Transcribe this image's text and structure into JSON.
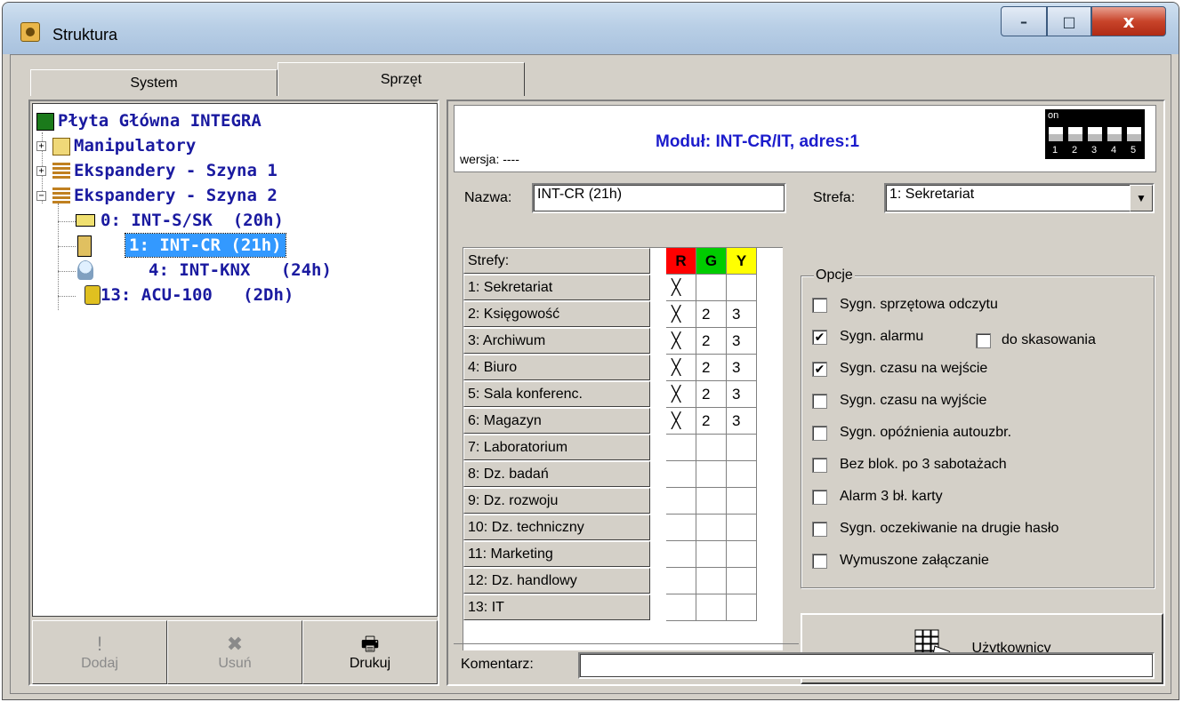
{
  "window": {
    "title": "Struktura",
    "min_label": "–",
    "max_label": "□",
    "close_label": "x"
  },
  "tabs": [
    {
      "label": "System",
      "active": false
    },
    {
      "label": "Sprzęt",
      "active": true
    }
  ],
  "tree": {
    "root": "Płyta Główna INTEGRA",
    "manipulatory": "Manipulatory",
    "szyna1": "Ekspandery - Szyna 1",
    "szyna2": "Ekspandery - Szyna 2",
    "items": [
      "0: INT-S/SK  (20h)",
      "1: INT-CR (21h)",
      "4: INT-KNX   (24h)",
      "13: ACU-100   (2Dh)"
    ],
    "selected_index": 1
  },
  "left_buttons": {
    "add": "Dodaj",
    "remove": "Usuń",
    "print": "Drukuj"
  },
  "module": {
    "title": "Moduł: INT-CR/IT, adres:1",
    "version": "wersja: ----",
    "dip_on_label": "on",
    "dip_numbers": [
      "1",
      "2",
      "3",
      "4",
      "5"
    ]
  },
  "form": {
    "name_label": "Nazwa:",
    "name_value": "INT-CR (21h)",
    "zone_label": "Strefa:",
    "zone_value": "1: Sekretariat"
  },
  "zones_table": {
    "header": "Strefy:",
    "col_labels": [
      "R",
      "G",
      "Y"
    ],
    "col_colors": [
      "#ff0000",
      "#00cc00",
      "#ffff00"
    ],
    "rows": [
      {
        "name": "1: Sekretariat",
        "r": "╳",
        "g": "",
        "y": ""
      },
      {
        "name": "2: Księgowość",
        "r": "╳",
        "g": "2",
        "y": "3"
      },
      {
        "name": "3: Archiwum",
        "r": "╳",
        "g": "2",
        "y": "3"
      },
      {
        "name": "4: Biuro",
        "r": "╳",
        "g": "2",
        "y": "3"
      },
      {
        "name": "5: Sala konferenc.",
        "r": "╳",
        "g": "2",
        "y": "3"
      },
      {
        "name": "6: Magazyn",
        "r": "╳",
        "g": "2",
        "y": "3"
      },
      {
        "name": "7: Laboratorium",
        "r": "",
        "g": "",
        "y": ""
      },
      {
        "name": "8: Dz. badań",
        "r": "",
        "g": "",
        "y": ""
      },
      {
        "name": "9: Dz. rozwoju",
        "r": "",
        "g": "",
        "y": ""
      },
      {
        "name": "10: Dz. techniczny",
        "r": "",
        "g": "",
        "y": ""
      },
      {
        "name": "11: Marketing",
        "r": "",
        "g": "",
        "y": ""
      },
      {
        "name": "12: Dz. handlowy",
        "r": "",
        "g": "",
        "y": ""
      },
      {
        "name": "13: IT",
        "r": "",
        "g": "",
        "y": ""
      }
    ]
  },
  "options": {
    "title": "Opcje",
    "items": [
      {
        "label": "Sygn. sprzętowa odczytu",
        "checked": false
      },
      {
        "label": "Sygn. alarmu",
        "checked": true
      },
      {
        "label": "Sygn. czasu na wejście",
        "checked": true
      },
      {
        "label": "Sygn. czasu na wyjście",
        "checked": false
      },
      {
        "label": "Sygn. opóźnienia autouzbr.",
        "checked": false
      },
      {
        "label": "Bez blok. po 3 sabotażach",
        "checked": false
      },
      {
        "label": "Alarm 3 bł. karty",
        "checked": false
      },
      {
        "label": "Sygn. oczekiwanie na drugie hasło",
        "checked": false
      },
      {
        "label": "Wymuszone załączanie",
        "checked": false
      }
    ],
    "extra": {
      "label": "do skasowania",
      "checked": false
    }
  },
  "users_button": "Użytkownicy",
  "comment": {
    "label": "Komentarz:",
    "value": ""
  }
}
